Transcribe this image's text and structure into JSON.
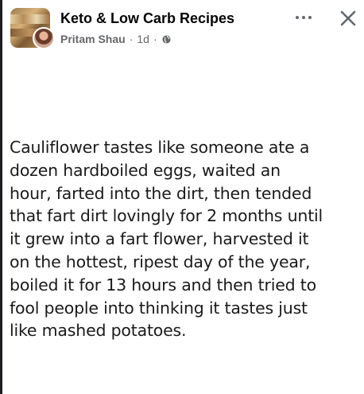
{
  "post": {
    "group_name": "Keto & Low Carb Recipes",
    "author": "Pritam Shau",
    "separator": "·",
    "time": "1d",
    "visibility_icon": "globe-icon"
  },
  "actions": {
    "more_icon": "more-options-icon",
    "close_icon": "close-icon"
  },
  "content": {
    "text": "Cauliflower tastes like someone ate a\ndozen hardboiled eggs, waited an\nhour, farted into the dirt, then tended\nthat fart dirt lovingly for 2 months until\nit grew into a fart flower, harvested it\non the hottest, ripest day of the year,\nboiled it for 13 hours and then tried to\nfool people into thinking it tastes just\nlike mashed potatoes."
  },
  "colors": {
    "primary_text": "#050505",
    "secondary_text": "#65676b",
    "background": "#ffffff"
  }
}
